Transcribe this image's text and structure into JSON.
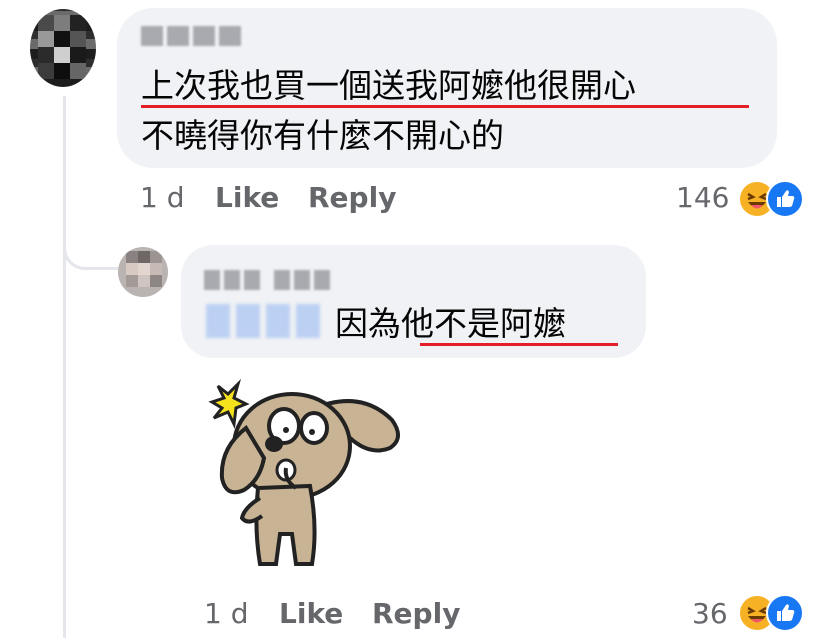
{
  "comment": {
    "text_line1": "上次我也買一個送我阿嬤他很開心",
    "text_line2": "不曉得你有什麼不開心的",
    "time": "1 d",
    "like_label": "Like",
    "reply_label": "Reply",
    "reaction_count": "146"
  },
  "reply": {
    "text": "因為他不是阿嬤",
    "time": "1 d",
    "like_label": "Like",
    "reply_label": "Reply",
    "reaction_count": "36",
    "sticker": "surprised-dog-sticker"
  },
  "colors": {
    "bubble_bg": "#f0f2f5",
    "meta_text": "#65676b",
    "underline": "#e41e27",
    "like_blue": "#1877f2",
    "haha_yellow": "#f7b125"
  }
}
